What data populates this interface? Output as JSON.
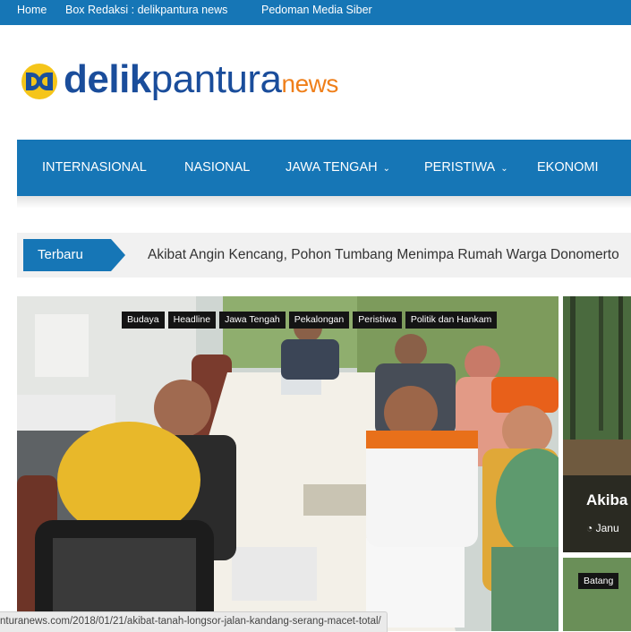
{
  "topbar": {
    "links": [
      "Home",
      "Box Redaksi : delikpantura news",
      "Pedoman Media Siber"
    ]
  },
  "logo": {
    "part1": "delik",
    "part2": "pantura",
    "part3": "news"
  },
  "nav": {
    "items": [
      "INTERNASIONAL",
      "NASIONAL",
      "JAWA TENGAH",
      "PERISTIWA",
      "EKONOMI"
    ]
  },
  "ticker": {
    "label": "Terbaru",
    "headline": "Akibat Angin Kencang, Pohon Tumbang Menimpa Rumah Warga Donomerto"
  },
  "hero": {
    "tags": [
      "Budaya",
      "Headline",
      "Jawa Tengah",
      "Pekalongan",
      "Peristiwa",
      "Politik dan Hankam"
    ]
  },
  "side": {
    "title": "Akiba",
    "date": "Janu",
    "tag2": "Batang"
  },
  "status": {
    "url": "nturanews.com/2018/01/21/akibat-tanah-longsor-jalan-kandang-serang-macet-total/"
  },
  "colors": {
    "brand": "#1676b6",
    "logo_blue": "#1a4d9b",
    "logo_orange": "#ef7f1a",
    "tag_bg": "#141414"
  }
}
